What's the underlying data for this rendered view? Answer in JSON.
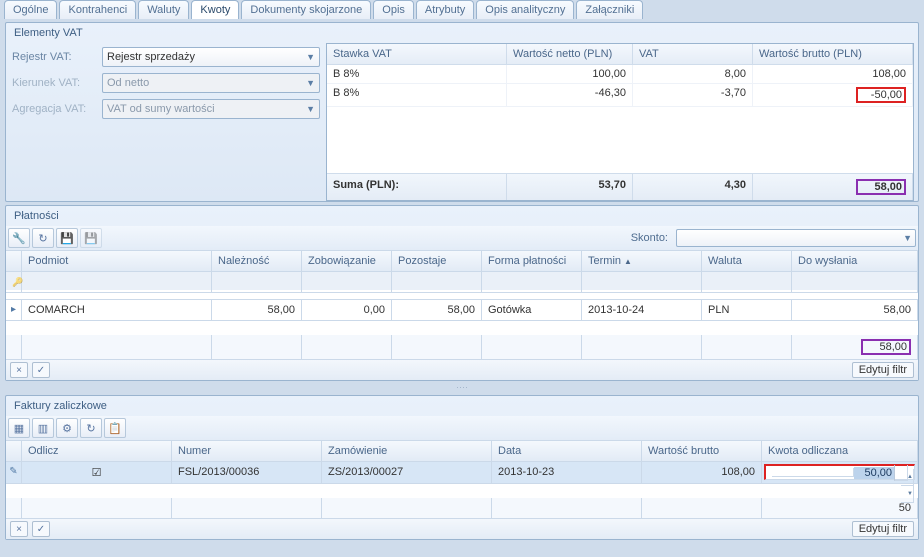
{
  "tabs": [
    "Ogólne",
    "Kontrahenci",
    "Waluty",
    "Kwoty",
    "Dokumenty skojarzone",
    "Opis",
    "Atrybuty",
    "Opis analityczny",
    "Załączniki"
  ],
  "activeTab": "Kwoty",
  "vatPanel": {
    "title": "Elementy VAT",
    "rejestrLabel": "Rejestr VAT:",
    "rejestrValue": "Rejestr sprzedaży",
    "kierunekLabel": "Kierunek VAT:",
    "kierunekValue": "Od netto",
    "agregacjaLabel": "Agregacja VAT:",
    "agregacjaValue": "VAT od sumy wartości",
    "headers": [
      "Stawka VAT",
      "Wartość netto (PLN)",
      "VAT",
      "Wartość brutto (PLN)"
    ],
    "rows": [
      {
        "stawka": "B 8%",
        "netto": "100,00",
        "vat": "8,00",
        "brutto": "108,00"
      },
      {
        "stawka": "B 8%",
        "netto": "-46,30",
        "vat": "-3,70",
        "brutto": "-50,00",
        "brutto_hl": "red"
      }
    ],
    "sumLabel": "Suma (PLN):",
    "sumNetto": "53,70",
    "sumVat": "4,30",
    "sumBrutto": "58,00"
  },
  "payPanel": {
    "title": "Płatności",
    "skontoLabel": "Skonto:",
    "headers": [
      "Podmiot",
      "Należność",
      "Zobowiązanie",
      "Pozostaje",
      "Forma płatności",
      "Termin",
      "Waluta",
      "Do wysłania"
    ],
    "row": {
      "podmiot": "COMARCH",
      "nalez": "58,00",
      "zob": "0,00",
      "pozost": "58,00",
      "forma": "Gotówka",
      "termin": "2013-10-24",
      "waluta": "PLN",
      "dowys": "58,00"
    },
    "footerTotal": "58,00",
    "editFilter": "Edytuj filtr"
  },
  "advPanel": {
    "title": "Faktury zaliczkowe",
    "headers": [
      "Odlicz",
      "Numer",
      "Zamówienie",
      "Data",
      "Wartość brutto",
      "Kwota odliczana"
    ],
    "row": {
      "odlicz": true,
      "numer": "FSL/2013/00036",
      "zam": "ZS/2013/00027",
      "data": "2013-10-23",
      "brutto": "108,00",
      "kwota": "50,00"
    },
    "footerTotal": "50",
    "editFilter": "Edytuj filtr"
  }
}
